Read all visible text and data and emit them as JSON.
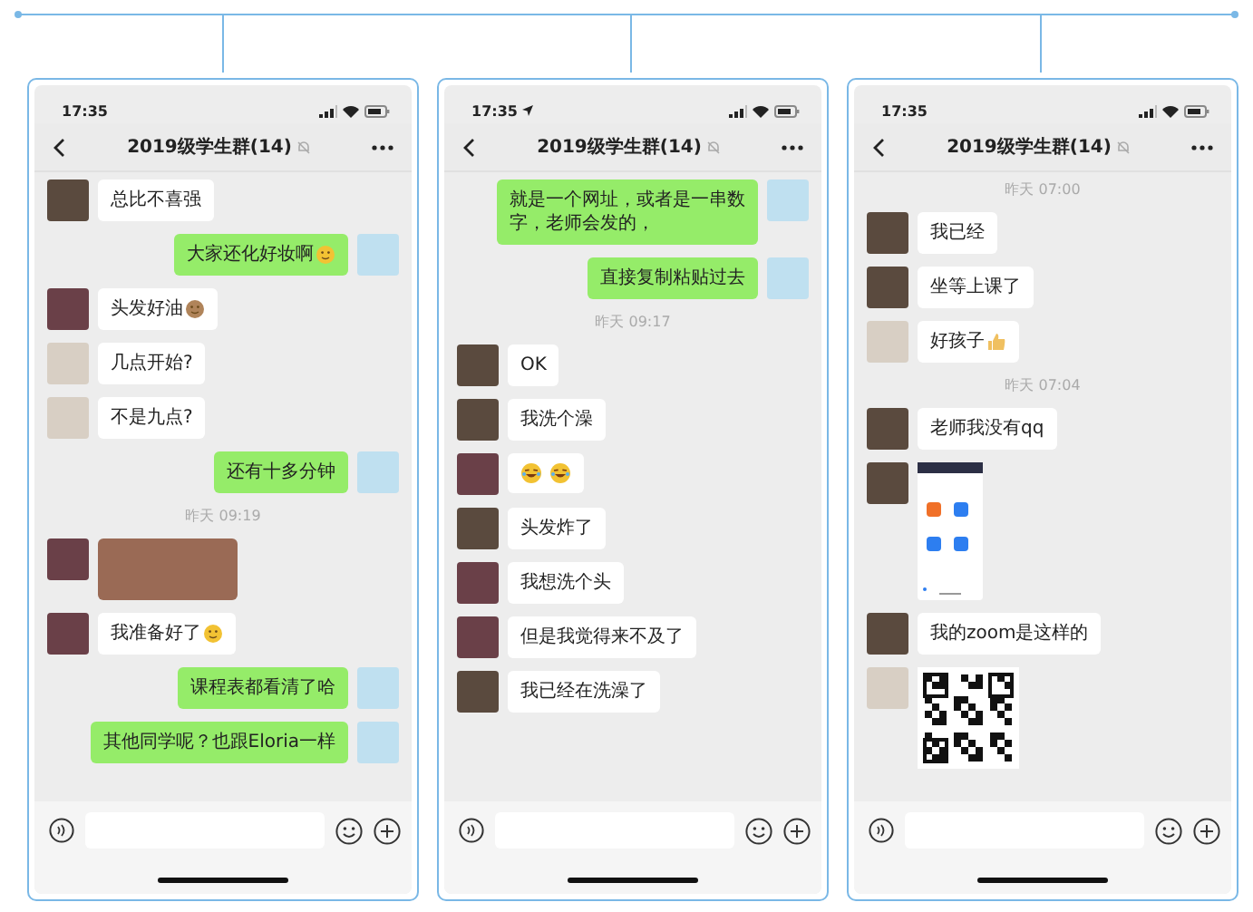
{
  "phones": [
    {
      "time": "17:35",
      "location": false,
      "title": "2019级学生群(14)",
      "messages": [
        {
          "kind": "text",
          "mine": false,
          "color": "#5a4a3e",
          "text": "总比不喜强"
        },
        {
          "kind": "text",
          "mine": true,
          "color": "#bfe0f0",
          "text": "大家还化好妆啊",
          "emoji": {
            "kind": "face"
          }
        },
        {
          "kind": "text",
          "mine": false,
          "color": "#6a4048",
          "text": "头发好油",
          "emoji": {
            "kind": "monkey"
          }
        },
        {
          "kind": "text",
          "mine": false,
          "color": "#d8cfc4",
          "text": "几点开始?"
        },
        {
          "kind": "text",
          "mine": false,
          "color": "#d8cfc4",
          "text": "不是九点?"
        },
        {
          "kind": "text",
          "mine": true,
          "color": "#bfe0f0",
          "text": "还有十多分钟"
        },
        {
          "kind": "time",
          "text": "昨天 09:19"
        },
        {
          "kind": "photo",
          "mine": false,
          "color": "#6a4048"
        },
        {
          "kind": "text",
          "mine": false,
          "color": "#6a4048",
          "text": "我准备好了",
          "emoji": {
            "kind": "face"
          }
        },
        {
          "kind": "text",
          "mine": true,
          "color": "#bfe0f0",
          "text": "课程表都看清了哈"
        },
        {
          "kind": "text",
          "mine": true,
          "color": "#bfe0f0",
          "text": "其他同学呢？也跟Eloria一样"
        }
      ]
    },
    {
      "time": "17:35",
      "location": true,
      "title": "2019级学生群(14)",
      "messages": [
        {
          "kind": "text",
          "mine": true,
          "color": "#bfe0f0",
          "text": "就是一个网址，或者是一串数字，老师会发的，"
        },
        {
          "kind": "text",
          "mine": true,
          "color": "#bfe0f0",
          "text": "直接复制粘贴过去"
        },
        {
          "kind": "time",
          "text": "昨天 09:17"
        },
        {
          "kind": "text",
          "mine": false,
          "color": "#5a4a3e",
          "text": "OK"
        },
        {
          "kind": "text",
          "mine": false,
          "color": "#5a4a3e",
          "text": "我洗个澡"
        },
        {
          "kind": "emojis",
          "mine": false,
          "color": "#6a4048",
          "emojis": [
            {
              "kind": "laugh"
            },
            {
              "kind": "laugh"
            }
          ]
        },
        {
          "kind": "text",
          "mine": false,
          "color": "#5a4a3e",
          "text": "头发炸了"
        },
        {
          "kind": "text",
          "mine": false,
          "color": "#6a4048",
          "text": "我想洗个头"
        },
        {
          "kind": "text",
          "mine": false,
          "color": "#6a4048",
          "text": "但是我觉得来不及了"
        },
        {
          "kind": "text",
          "mine": false,
          "color": "#5a4a3e",
          "text": "我已经在洗澡了"
        }
      ]
    },
    {
      "time": "17:35",
      "location": false,
      "title": "2019级学生群(14)",
      "messages": [
        {
          "kind": "time",
          "text": "昨天 07:00"
        },
        {
          "kind": "text",
          "mine": false,
          "color": "#5a4a3e",
          "text": "我已经"
        },
        {
          "kind": "text",
          "mine": false,
          "color": "#5a4a3e",
          "text": "坐等上课了"
        },
        {
          "kind": "text",
          "mine": false,
          "color": "#d8cfc4",
          "text": "好孩子",
          "emoji": {
            "kind": "thumb"
          }
        },
        {
          "kind": "time",
          "text": "昨天 07:04"
        },
        {
          "kind": "text",
          "mine": false,
          "color": "#5a4a3e",
          "text": "老师我没有qq"
        },
        {
          "kind": "screenshot",
          "mine": false,
          "color": "#5a4a3e"
        },
        {
          "kind": "text",
          "mine": false,
          "color": "#5a4a3e",
          "text": "我的zoom是这样的"
        },
        {
          "kind": "qr",
          "mine": false,
          "color": "#d8cfc4"
        }
      ]
    }
  ]
}
